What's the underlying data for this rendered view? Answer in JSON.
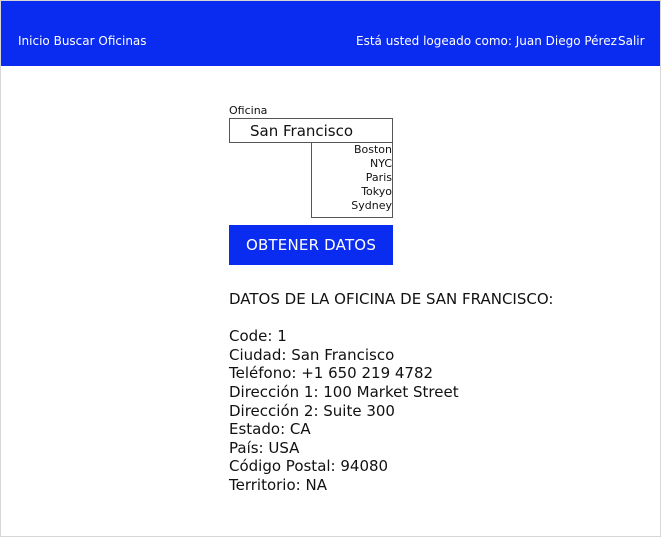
{
  "nav": {
    "home_label": "Inicio",
    "search_offices_label": "Buscar Oficinas",
    "user_text": "Está usted logeado como: Juan Diego Pérez",
    "logout_label": "Salir"
  },
  "form": {
    "label": "Oficina",
    "selected": "San Francisco",
    "options": [
      "Boston",
      "NYC",
      "Paris",
      "Tokyo",
      "Sydney"
    ],
    "button_label": "OBTENER DATOS"
  },
  "result": {
    "title": "DATOS DE LA OFICINA DE SAN FRANCISCO:",
    "rows": [
      "Code: 1",
      "Ciudad: San Francisco",
      "Teléfono: +1 650 219 4782",
      "Dirección 1: 100 Market Street",
      "Dirección 2: Suite 300",
      "Estado: CA",
      "País: USA",
      "Código Postal: 94080",
      "Territorio: NA"
    ]
  },
  "colors": {
    "primary": "#0a2bf0",
    "text": "#111111",
    "background": "#ffffff"
  }
}
